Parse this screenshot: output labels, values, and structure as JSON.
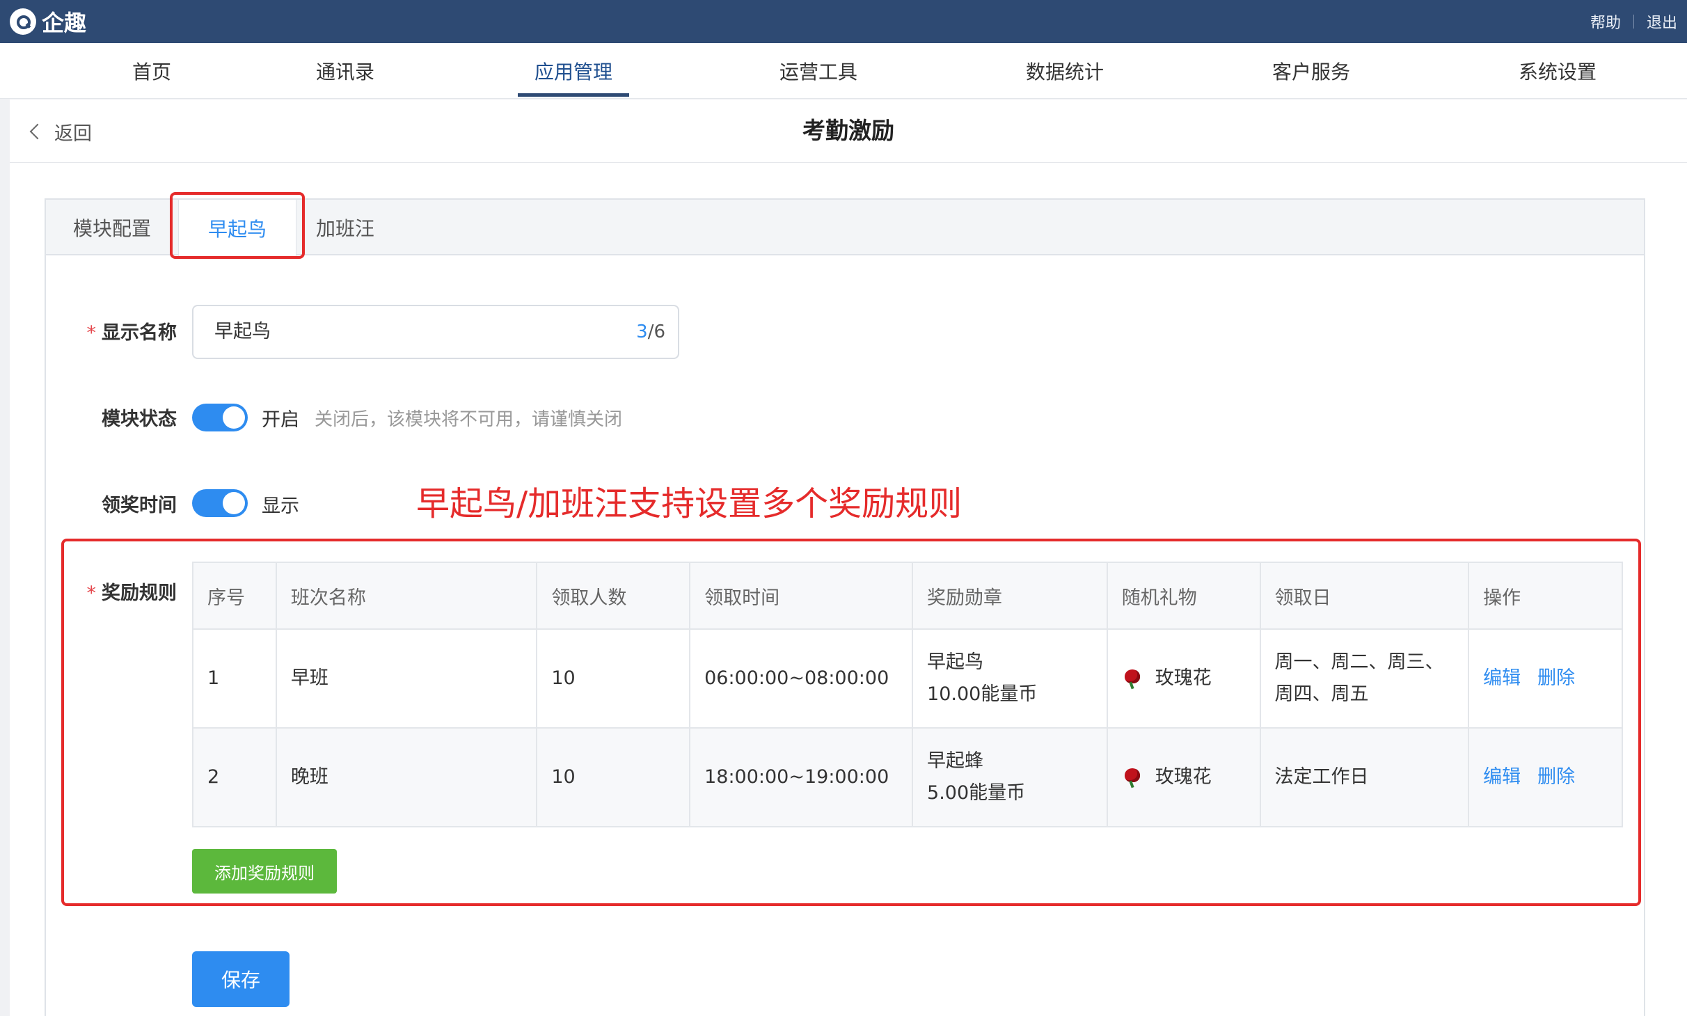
{
  "brand": {
    "name": "企趣",
    "logo_icon": "qiqu-logo-icon"
  },
  "top_links": {
    "help": "帮助",
    "logout": "退出"
  },
  "nav": [
    "首页",
    "通讯录",
    "应用管理",
    "运营工具",
    "数据统计",
    "客户服务",
    "系统设置"
  ],
  "nav_active": "应用管理",
  "page": {
    "back_label": "返回",
    "title": "考勤激励"
  },
  "tabs": [
    "模块配置",
    "早起鸟",
    "加班汪"
  ],
  "tab_active": "早起鸟",
  "form": {
    "display_name_label": "显示名称",
    "display_name_value": "早起鸟",
    "display_name_count_current": "3",
    "display_name_count_max": "/6",
    "module_status_label": "模块状态",
    "module_status_text": "开启",
    "module_status_hint": "关闭后，该模块将不可用，请谨慎关闭",
    "claim_time_label": "领奖时间",
    "claim_time_text": "显示",
    "reward_rules_label": "奖励规则"
  },
  "annotation": "早起鸟/加班汪支持设置多个奖励规则",
  "table": {
    "headers": [
      "序号",
      "班次名称",
      "领取人数",
      "领取时间",
      "奖励勋章",
      "随机礼物",
      "领取日",
      "操作"
    ],
    "rows": [
      {
        "no": "1",
        "shift": "早班",
        "count": "10",
        "time": "06:00:00~08:00:00",
        "medal_name": "早起鸟",
        "medal_coins": "10.00能量币",
        "gift": "玫瑰花",
        "days_line1": "周一、周二、周三、",
        "days_line2": "周四、周五",
        "edit": "编辑",
        "delete": "删除"
      },
      {
        "no": "2",
        "shift": "晚班",
        "count": "10",
        "time": "18:00:00~19:00:00",
        "medal_name": "早起蜂",
        "medal_coins": "5.00能量币",
        "gift": "玫瑰花",
        "days_line1": "法定工作日",
        "days_line2": "",
        "edit": "编辑",
        "delete": "删除"
      }
    ]
  },
  "buttons": {
    "add_rule": "添加奖励规则",
    "save": "保存"
  },
  "colors": {
    "topbar": "#2e4a73",
    "accent": "#2e8cf0",
    "add_button": "#5cb83c",
    "highlight": "#e52b2b"
  }
}
